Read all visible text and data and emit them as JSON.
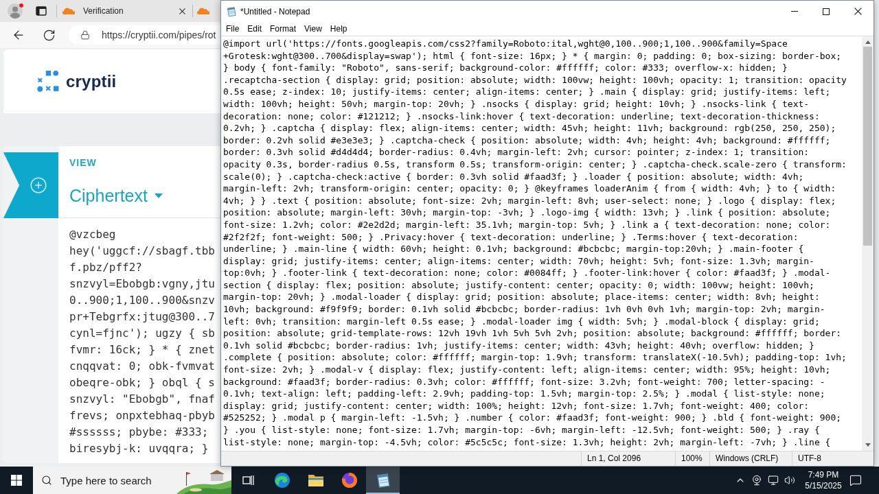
{
  "browser": {
    "tabs": [
      {
        "title": "Verification",
        "selected": false
      },
      {
        "selected": false
      }
    ],
    "address": "https://cryptii.com/pipes/rot",
    "page": {
      "logo": "cryptii",
      "view_label": "VIEW",
      "view_name": "Ciphertext",
      "ciphertext_lines": [
        "@vzcbeg",
        "hey('uggcf://sbagf.tbb",
        "f.pbz/pff2?",
        "snzvyl=Ebobgb:vgny,jtu",
        "0..900;1,100..900&snzv",
        "pr+Tebgrfx:jtug@300..7",
        "cynl=fjnc'); ugzy { sb",
        "fvmr: 16ck; } * { znet",
        "cnqqvat: 0; obk-fvmvat",
        "obeqre-obk; } obql { s",
        "snzvyl: \"Ebobgb\", fnaf",
        "frevs; onpxtebhaq-pbyb",
        "#ssssss; pbybe: #333;",
        "biresybj-k: uvqqra; }"
      ]
    }
  },
  "notepad": {
    "title": "*Untitled - Notepad",
    "menu": [
      "File",
      "Edit",
      "Format",
      "View",
      "Help"
    ],
    "text_lines": [
      "@import url('https://fonts.googleapis.com/css2?family=Roboto:ital,wght@0,100..900;1,100..900&family=Space",
      "+Grotesk:wght@300..700&display=swap'); html { font-size: 16px; } * { margin: 0; padding: 0; box-sizing: border-box;",
      "} body { font-family: \"Roboto\", sans-serif; background-color: #ffffff; color: #333; overflow-x: hidden; }",
      ".recaptcha-section { display: grid; position: absolute; width: 100vw; height: 100vh; opacity: 1; transition: opacity",
      "0.5s ease; z-index: 10; justify-items: center; align-items: center; } .main { display: grid; justify-items: left;",
      "width: 100vh; height: 50vh; margin-top: 20vh; } .nsocks { display: grid; height: 10vh; } .nsocks-link { text-",
      "decoration: none; color: #121212; } .nsocks-link:hover { text-decoration: underline; text-decoration-thickness:",
      "0.2vh; } .captcha { display: flex; align-items: center; width: 45vh; height: 11vh; background: rgb(250, 250, 250);",
      "border: 0.2vh solid #e3e3e3; } .captcha-check { position: absolute; width: 4vh; height: 4vh; background: #ffffff;",
      "border: 0.3vh solid #d4d4d4; border-radius: 0.4vh; margin-left: 2vh; cursor: pointer; z-index: 1; transition:",
      "opacity 0.3s, border-radius 0.5s, transform 0.5s; transform-origin: center; } .captcha-check.scale-zero { transform:",
      "scale(0); } .captcha-check:active { border: 0.3vh solid #faad3f; } .loader { position: absolute; width: 4vh;",
      "margin-left: 2vh; transform-origin: center; opacity: 0; } @keyframes loaderAnim { from { width: 4vh; } to { width:",
      "4vh; } } .text { position: absolute; font-size: 2vh; margin-left: 8vh; user-select: none; } .logo { display: flex;",
      "position: absolute; margin-left: 30vh; margin-top: -3vh; } .logo-img { width: 13vh; } .link { position: absolute;",
      "font-size: 1.2vh; color: #2e2d2d; margin-left: 35.1vh; margin-top: 5vh; } .link a { text-decoration: none; color:",
      "#2f2f2f; font-weight: 500; } .Privacy:hover { text-decoration: underline; } .Terms:hover { text-decoration:",
      "underline; } .main-line { width: 60vh; height: 0.1vh; background: #bcbcbc; margin-top:20vh; } .main-footer {",
      "display: grid; justify-items: center; align-items: center; width: 70vh; height: 5vh; font-size: 1.3vh; margin-",
      "top:0vh; } .footer-link { text-decoration: none; color: #0084ff; } .footer-link:hover { color: #faad3f; } .modal-",
      "section { display: flex; position: absolute; justify-content: center; opacity: 0; width: 100vw; height: 100vh;",
      "margin-top: 20vh; } .modal-loader { display: grid; position: absolute; place-items: center; width: 8vh; height:",
      "10vh; background: #f9f9f9; border: 0.1vh solid #bcbcbc; border-radius: 1vh 0vh 0vh 1vh; margin-top: 2vh; margin-",
      "left: 0vh; transition: margin-left 0.5s ease; } .modal-loader img { width: 5vh; } .modal-block { display: grid;",
      "position: absolute; grid-template-rows: 12vh 19vh 1vh 5vh 5vh 2vh; position: absolute; background: #ffffff; border:",
      "0.1vh solid #bcbcbc; border-radius: 1vh; justify-items: center; width: 43vh; height: 40vh; overflow: hidden; }",
      ".complete { position: absolute; color: #ffffff; margin-top: 1.9vh; transform: translateX(-10.5vh); padding-top: 1vh;",
      "font-size: 2vh; } .modal-v { display: flex; justify-content: left; align-items: center; width: 95%; height: 10vh;",
      "background: #faad3f; border-radius: 0.3vh; color: #ffffff; font-size: 3.2vh; font-weight: 700; letter-spacing: -",
      "0.1vh; text-align: left; padding-left: 2.9vh; padding-top: 1.5vh; margin-top: 2.5%; } .modal { list-style: none;",
      "display: grid; justify-content: center; width: 100%; height: 12vh; font-size: 1.7vh; font-weight: 400; color:",
      "#525252; } .modal p { margin-left: -1.5vh; } .number { color: #faad3f; font-weight: 900; } .bld { font-weight: 900;",
      "} .you { list-style: none; font-size: 1.7vh; margin-top: -6vh; margin-left: -12.5vh; font-weight: 500; } .ray {",
      "list-style: none; margin-top: -4.5vh; color: #5c5c5c; font-size: 1.3vh; height: 2vh; margin-left: -7vh; } .line {"
    ],
    "status_bar": [
      "Ln 1, Col 2096",
      "100%",
      "Windows (CRLF)",
      "UTF-8"
    ]
  },
  "taskbar": {
    "search": {
      "placeholder": "Type here to search"
    },
    "apps": [
      {
        "kind": "swirl",
        "selected": false
      },
      {
        "kind": "folder",
        "selected": false
      },
      {
        "kind": "fox",
        "selected": false
      },
      {
        "kind": "notepad",
        "selected": true
      }
    ],
    "clock": {
      "time": "7:49 PM",
      "date": "5/15/2025"
    }
  }
}
